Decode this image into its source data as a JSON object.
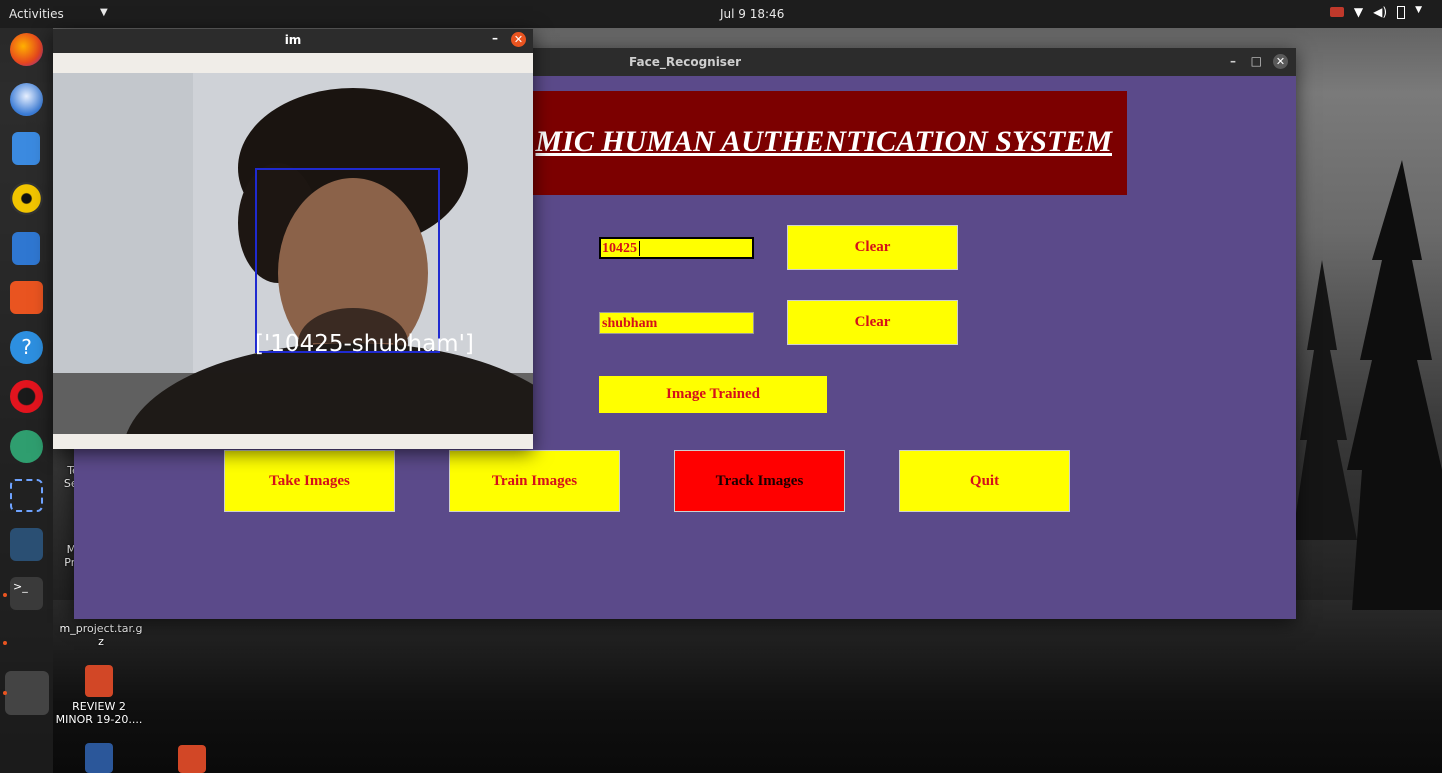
{
  "topbar": {
    "activities": "Activities",
    "clock": "Jul 9  18:46"
  },
  "dock": {
    "apps": [
      "firefox-icon",
      "thunderbird-icon",
      "files-icon",
      "rhythmbox-icon",
      "writer-icon",
      "software-icon",
      "help-icon",
      "opera-icon",
      "android-studio-icon",
      "screenshot-icon",
      "mysql-workbench-icon",
      "terminal-icon",
      "show-apps-icon"
    ]
  },
  "desktop": {
    "items": [
      {
        "label_1": "Te",
        "label_2": "Ser"
      },
      {
        "label_1": "MI",
        "label_2": "Pre"
      },
      {
        "label_1": "m_project.tar.g",
        "label_2": "z"
      },
      {
        "label_1": "REVIEW 2",
        "label_2": "MINOR 19-20...."
      }
    ]
  },
  "face_recogniser": {
    "window_title": "Face_Recogniser",
    "banner": "MIC HUMAN AUTHENTICATION SYSTEM",
    "id_value": "10425",
    "name_value": "shubham",
    "clear_id": "Clear",
    "clear_name": "Clear",
    "status": "Image Trained",
    "buttons": {
      "take": "Take Images",
      "train": "Train Images",
      "track": "Track Images",
      "quit": "Quit"
    }
  },
  "im_window": {
    "title": "im",
    "minimize": "–",
    "detection_label": "['10425-shubham']"
  }
}
